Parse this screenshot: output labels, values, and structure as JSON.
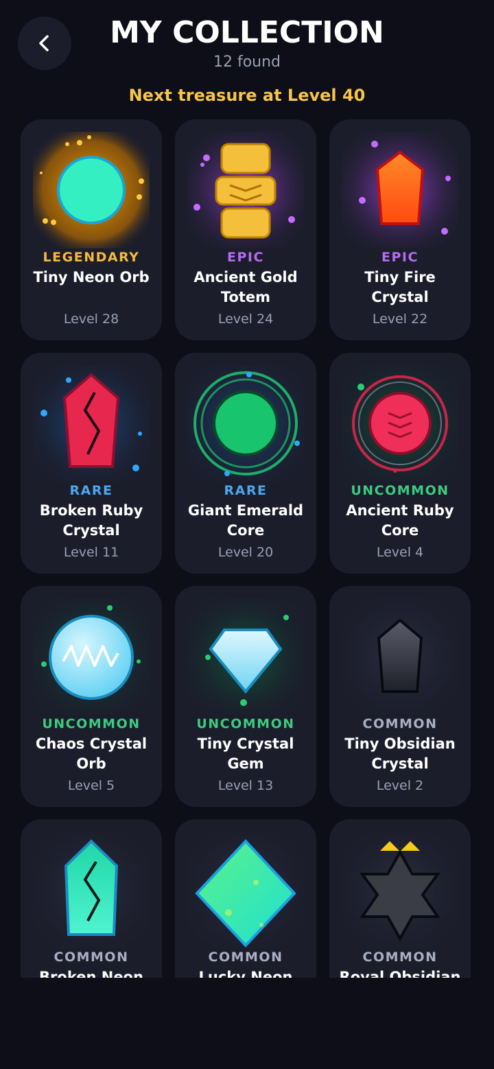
{
  "header": {
    "title": "MY COLLECTION",
    "subtitle": "12 found",
    "next_treasure": "Next treasure at Level 40"
  },
  "items": [
    {
      "rarity": "LEGENDARY",
      "name": "Tiny Neon Orb",
      "level": "Level 28"
    },
    {
      "rarity": "EPIC",
      "name": "Ancient Gold Totem",
      "level": "Level 24"
    },
    {
      "rarity": "EPIC",
      "name": "Tiny Fire Crystal",
      "level": "Level 22"
    },
    {
      "rarity": "RARE",
      "name": "Broken Ruby Crystal",
      "level": "Level 11"
    },
    {
      "rarity": "RARE",
      "name": "Giant Emerald Core",
      "level": "Level 20"
    },
    {
      "rarity": "UNCOMMON",
      "name": "Ancient Ruby Core",
      "level": "Level 4"
    },
    {
      "rarity": "UNCOMMON",
      "name": "Chaos Crystal Orb",
      "level": "Level 5"
    },
    {
      "rarity": "UNCOMMON",
      "name": "Tiny Crystal Gem",
      "level": "Level 13"
    },
    {
      "rarity": "COMMON",
      "name": "Tiny Obsidian Crystal",
      "level": "Level 2"
    },
    {
      "rarity": "COMMON",
      "name": "Broken Neon",
      "level": ""
    },
    {
      "rarity": "COMMON",
      "name": "Lucky Neon",
      "level": ""
    },
    {
      "rarity": "COMMON",
      "name": "Royal Obsidian",
      "level": ""
    }
  ],
  "colors": {
    "background": "#0d0e17",
    "card": "#1b1d2b",
    "legendary": "#f6b93b",
    "epic": "#b46cf0",
    "rare": "#4aa8f0",
    "uncommon": "#3ccb7f",
    "common": "#a9afc2",
    "accent": "#f6c549"
  }
}
